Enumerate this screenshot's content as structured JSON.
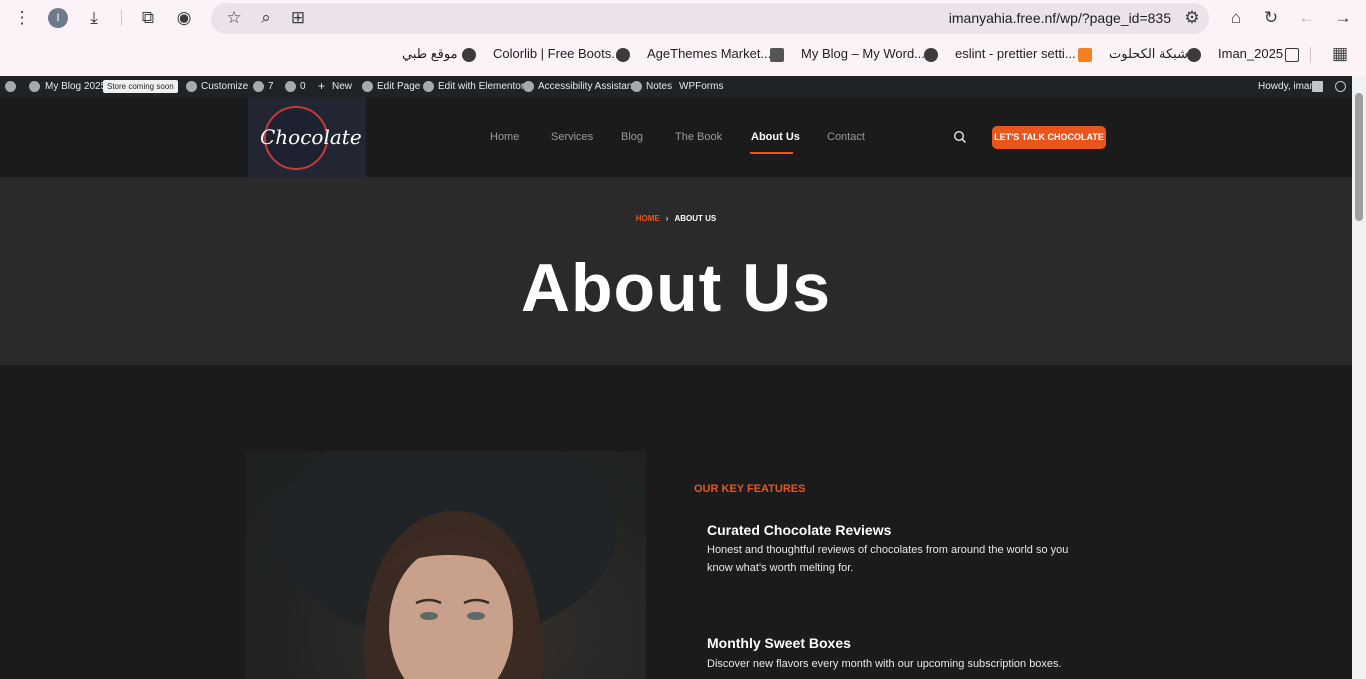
{
  "browser": {
    "url": "imanyahia.free.nf/wp/?page_id=835",
    "profile_initial": "I",
    "bookmarks": [
      "موقع طبي",
      "Colorlib | Free Boots...",
      "AgeThemes Market...",
      "My Blog – My Word...",
      "eslint - prettier setti...",
      "شبكة الكحلوت",
      "Iman_2025"
    ]
  },
  "wp_admin_bar": {
    "site_name": "My Blog 2025",
    "store_badge": "Store coming soon",
    "customize": "Customize",
    "updates": "7",
    "comments": "0",
    "new": "New",
    "edit_page": "Edit Page",
    "edit_elementor": "Edit with Elementor",
    "accessibility": "Accessibility Assistant",
    "notes": "Notes",
    "wpforms": "WPForms",
    "howdy": "Howdy, iman"
  },
  "site": {
    "logo_text": "Chocolate",
    "nav": [
      "Home",
      "Services",
      "Blog",
      "The Book",
      "About Us",
      "Contact"
    ],
    "active_nav": "About Us",
    "cta": "LET'S TALK CHOCOLATE"
  },
  "hero": {
    "breadcrumb_home": "HOME",
    "breadcrumb_current": "ABOUT US",
    "title": "About Us"
  },
  "features": {
    "label": "OUR KEY FEATURES",
    "items": [
      {
        "title": "Curated Chocolate Reviews",
        "desc": "Honest and thoughtful reviews of chocolates from around the world  so you know what's worth melting for."
      },
      {
        "title": "Monthly Sweet Boxes",
        "desc": "Discover new flavors every month with our upcoming subscription boxes."
      }
    ]
  },
  "colors": {
    "accent": "#e8561b",
    "page_bg": "#1b1b1b",
    "hero_bg": "#2a2a2a"
  }
}
